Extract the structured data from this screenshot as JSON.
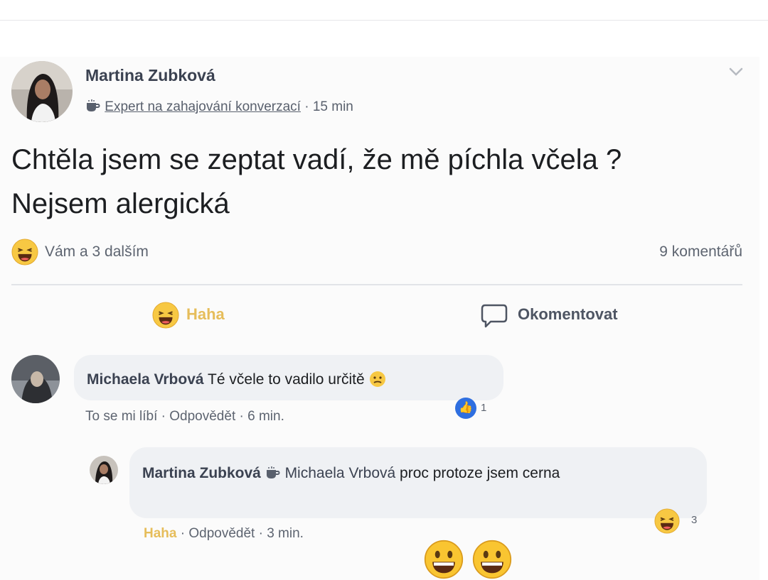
{
  "post": {
    "author": "Martina Zubková",
    "badge_icon": "coffee-cup-icon",
    "badge": "Expert na zahajování konverzací",
    "time": "· 15 min",
    "text": "Chtěla jsem se zeptat vadí, že mě píchla včela ? Nejsem alergická",
    "reactions": "Vám a 3 dalším",
    "comments_count": "9 komentářů"
  },
  "actions": {
    "haha": "Haha",
    "comment": "Okomentovat"
  },
  "comments": [
    {
      "author": "Michaela Vrbová",
      "text": "Té včele to vadilo určitě",
      "like": "To se mi líbí",
      "reply": "· Odpovědět",
      "time": "· 6 min.",
      "reaction_count": "1"
    },
    {
      "author": "Martina Zubková",
      "mention": "Michaela Vrbová",
      "text": "proc protoze jsem cerna",
      "reaction": "Haha",
      "reply": "· Odpovědět",
      "time": "· 3 min.",
      "reaction_count": "3"
    }
  ],
  "colors": {
    "haha_yellow": "#f7c843",
    "like_blue": "#2f6fe0",
    "bubble": "#eff1f4"
  }
}
